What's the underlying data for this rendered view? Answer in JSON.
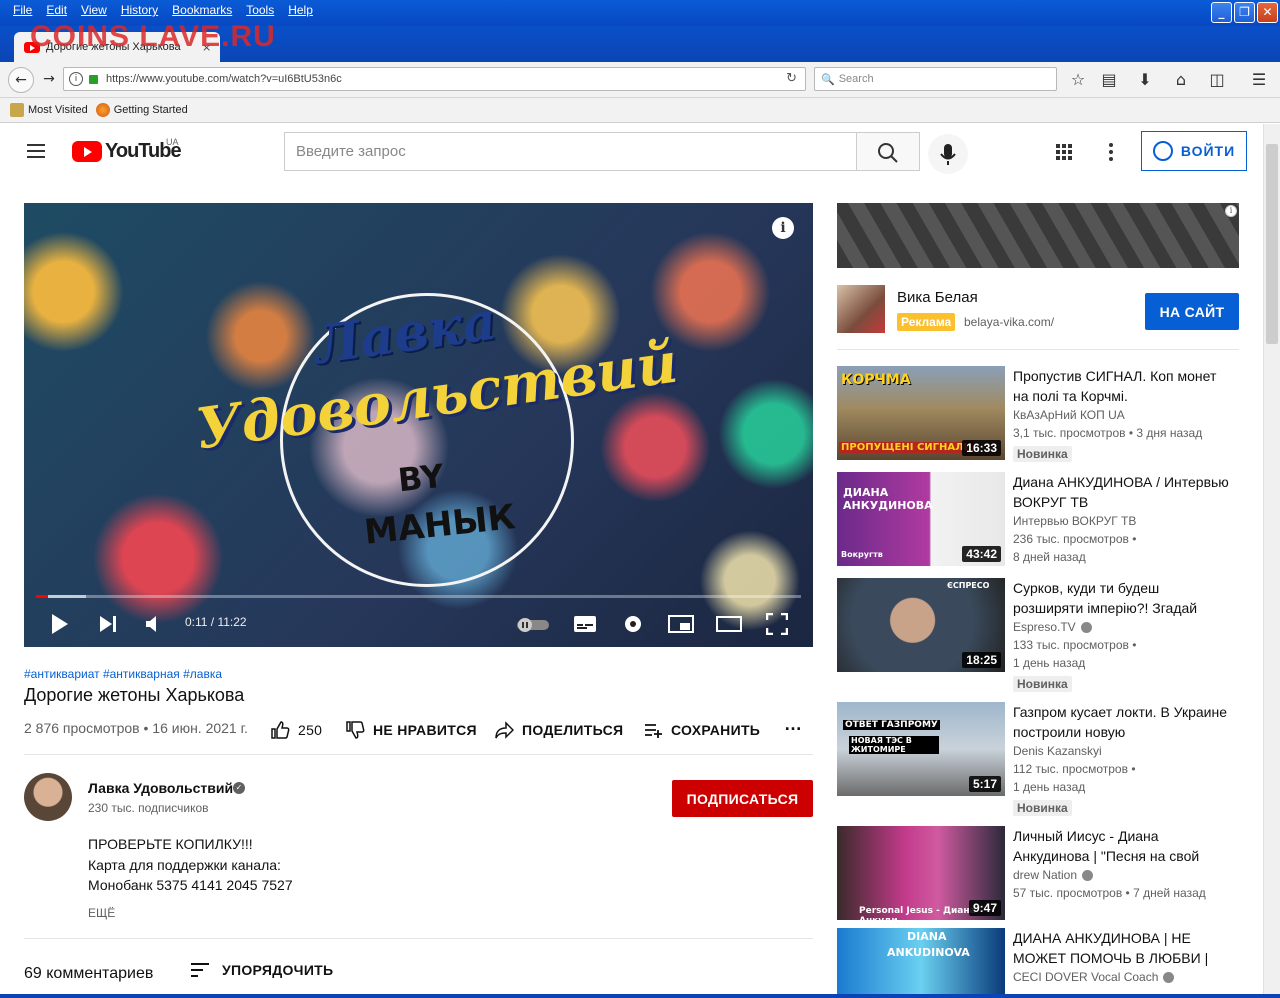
{
  "browser": {
    "menu": [
      "File",
      "Edit",
      "View",
      "History",
      "Bookmarks",
      "Tools",
      "Help"
    ],
    "tab_title": "Дорогие жетоны Харькова",
    "tab_close": "×",
    "watermark": "COINS LAVE.RU",
    "url": "https://www.youtube.com/watch?v=uI6BtU53n6c",
    "search_placeholder": "Search",
    "bookmarks": [
      "Most Visited",
      "Getting Started"
    ]
  },
  "youtube": {
    "logo_text": "YouTube",
    "region": "UA",
    "search_placeholder": "Введите запрос",
    "login_label": "ВОЙТИ"
  },
  "video": {
    "overlay_line1": "Лавка",
    "overlay_line2": "Удовольствий",
    "overlay_line3": "BY",
    "overlay_line4": "МАНЫК",
    "time": "0:11 / 11:22",
    "progress_fraction": 0.016,
    "hashtags": "#антиквариат #антикварная #лавка",
    "title": "Дорогие жетоны Харькова",
    "meta": "2 876 просмотров • 16 июн. 2021 г.",
    "likes": "250",
    "dislike_label": "НЕ НРАВИТСЯ",
    "share_label": "ПОДЕЛИТЬСЯ",
    "save_label": "СОХРАНИТЬ"
  },
  "channel": {
    "name": "Лавка Удовольствий",
    "subs": "230 тыс. подписчиков",
    "subscribe_label": "ПОДПИСАТЬСЯ",
    "description": [
      "ПРОВЕРЬТЕ КОПИЛКУ!!!",
      "Карта для поддержки канала:",
      "Монобанк 5375 4141 2045 7527"
    ],
    "more_label": "ЕЩЁ"
  },
  "comments": {
    "count": "69 комментариев",
    "sort_label": "УПОРЯДОЧИТЬ"
  },
  "ad": {
    "name": "Вика Белая",
    "badge": "Реклама",
    "domain": "belaya-vika.com/",
    "button": "НА САЙТ"
  },
  "recommendations": [
    {
      "title": "Пропустив СИГНАЛ. Коп монет на полі та Корчмі.",
      "channel": "КвАзАрНий КОП UA",
      "views": "3,1 тыс. просмотров • 3 дня назад",
      "age": "",
      "badge": "Новинка",
      "duration": "16:33",
      "thumb_text": "КОРЧМА",
      "thumb_text2": "ПРОПУЩЕНІ СИГНАЛИ"
    },
    {
      "title": "Диана АНКУДИНОВА / Интервью ВОКРУГ ТВ",
      "channel": "Интервью ВОКРУГ ТВ",
      "views": "236 тыс. просмотров •",
      "age": "8 дней назад",
      "badge": "",
      "duration": "43:42",
      "thumb_text": "ДИАНА АНКУДИНОВА",
      "thumb_text2": "Вокругтв"
    },
    {
      "title": "Сурков, куди ти будеш розширяти імперію?! Згадай",
      "channel": "Espreso.TV",
      "views": "133 тыс. просмотров •",
      "age": "1 день назад",
      "badge": "Новинка",
      "duration": "18:25",
      "thumb_text": "ЄСПРЕСО",
      "thumb_text2": ""
    },
    {
      "title": "Газпром кусает локти. В Украине построили новую",
      "channel": "Denis Kazanskyi",
      "views": "112 тыс. просмотров •",
      "age": "1 день назад",
      "badge": "Новинка",
      "duration": "5:17",
      "thumb_text": "ОТВЕТ ГАЗПРОМУ",
      "thumb_text2": "НОВАЯ ТЭС В ЖИТОМИРЕ"
    },
    {
      "title": "Личный Иисус - Диана Анкудинова | \"Песня на свой",
      "channel": "drew Nation",
      "views": "57 тыс. просмотров • 7 дней назад",
      "age": "",
      "badge": "",
      "duration": "9:47",
      "thumb_text": "Personal Jesus - Диана Анкуди...",
      "thumb_text2": ""
    },
    {
      "title": "ДИАНА АНКУДИНОВА | НЕ МОЖЕТ ПОМОЧЬ В ЛЮБВИ |",
      "channel": "CECI DOVER Vocal Coach",
      "views": "",
      "age": "",
      "badge": "",
      "duration": "",
      "thumb_text": "DIANA",
      "thumb_text2": "ANKUDINOVA"
    }
  ],
  "colors": {
    "youtube_red": "#ff0000",
    "link_blue": "#065fd4",
    "subscribe": "#cc0000",
    "badge_yellow": "#fbc02d"
  }
}
